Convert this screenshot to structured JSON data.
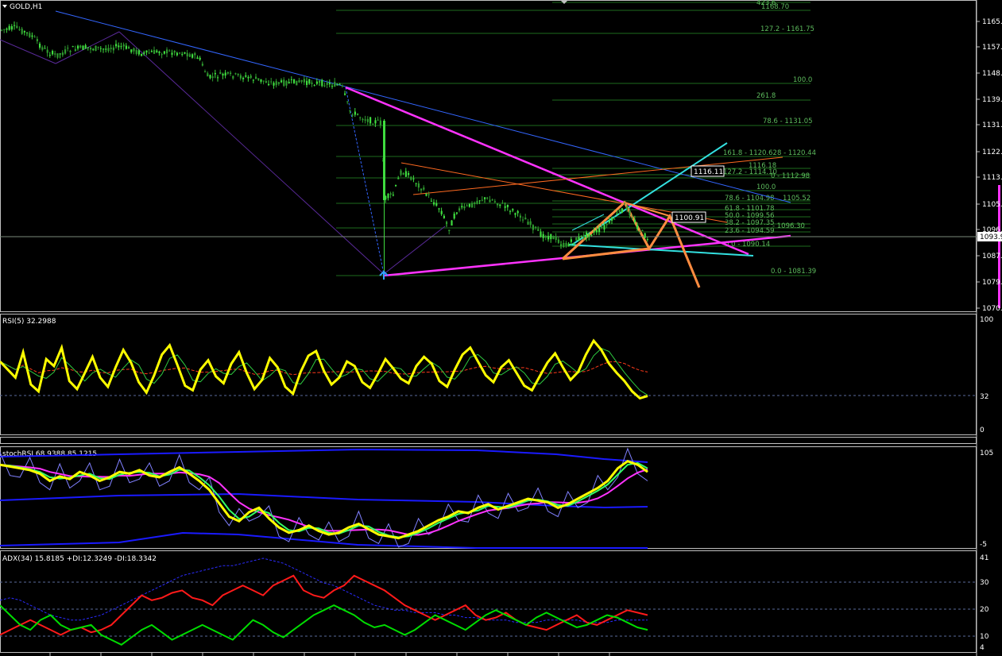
{
  "chart_title": "GOLD,H1",
  "colors": {
    "background": "#000000",
    "bull_candle": "#3fdc3f",
    "bear_candle": "#2f9a2f",
    "fib_line": "#1e6b1e",
    "fib_text": "#5dbb5d",
    "magenta": "#ff33ff",
    "blue_line": "#3366ff",
    "cyan": "#33e0e0",
    "orange": "#ff8040",
    "rsi": "#ffff00",
    "stoch_main": "#ffff00",
    "stoch_ma": "#ff33ff",
    "stoch_green": "#33ff66",
    "band": "#1a1aff",
    "adx_plus": "#00dd00",
    "adx_minus": "#ff1a1a",
    "adx_main": "#2b2bff"
  },
  "price_axis": {
    "ticks": [
      "1165.7",
      "1157.0",
      "1148.2",
      "1139.5",
      "1131.0",
      "1122.2",
      "1113.7",
      "1105.0",
      "1096.2",
      "1087.7",
      "1079.0",
      "1070.5"
    ],
    "current_price": "1093.9"
  },
  "fib_labels": {
    "f_423": "423.6",
    "f_top": "1168.70",
    "f_1272": "127.2 - 1161.75",
    "f_100a": "100.0",
    "f_2618": "261.8",
    "f_786a": "78.6 - 1131.05",
    "f_1618": "161.8 - 1120.628 - 1120.44",
    "f_1116": "1116.18",
    "f_1272b": "127.2 - 1114.10",
    "f_11298": "0 - 1112.98",
    "f_100b": "100.0",
    "f_786b": "78.6 - 1104.98",
    "f_10552": "1105.52",
    "f_618": "61.8 - 1101.78",
    "f_500": "50.0 - 1099.56",
    "f_382": "38.2 - 1097.35",
    "f_10963": "- 1096.30",
    "f_236": "23.6 - 1094.59",
    "f_0a": "0.0 - 1090.14",
    "f_0b": "0.0 - 1081.39"
  },
  "price_boxes": {
    "box1": "1116.11",
    "box2": "1100.91"
  },
  "rsi": {
    "label": "RSI(5) 32.2988",
    "axis": [
      "100",
      "32",
      "0"
    ],
    "series": [
      62,
      55,
      48,
      70,
      42,
      36,
      64,
      58,
      74,
      45,
      38,
      52,
      66,
      48,
      40,
      57,
      72,
      61,
      44,
      35,
      50,
      68,
      76,
      59,
      41,
      37,
      55,
      63,
      49,
      43,
      60,
      70,
      52,
      38,
      46,
      65,
      57,
      40,
      34,
      53,
      67,
      71,
      54,
      42,
      48,
      62,
      58,
      44,
      39,
      51,
      64,
      56,
      47,
      43,
      58,
      66,
      60,
      45,
      40,
      55,
      68,
      74,
      62,
      50,
      44,
      57,
      63,
      52,
      41,
      37,
      49,
      61,
      69,
      57,
      46,
      53,
      68,
      80,
      72,
      60,
      52,
      45,
      36,
      30,
      32
    ]
  },
  "stoch": {
    "label": "stochRSI 68.9388 85.1215",
    "axis": [
      "105",
      "-5"
    ],
    "main": [
      88,
      86,
      84,
      82,
      78,
      70,
      75,
      72,
      80,
      76,
      70,
      74,
      80,
      78,
      82,
      76,
      74,
      80,
      85,
      78,
      70,
      60,
      45,
      30,
      25,
      35,
      40,
      28,
      18,
      12,
      15,
      20,
      14,
      10,
      12,
      18,
      22,
      16,
      10,
      8,
      6,
      10,
      14,
      20,
      26,
      30,
      36,
      34,
      40,
      44,
      38,
      42,
      46,
      50,
      48,
      46,
      40,
      44,
      50,
      56,
      62,
      70,
      84,
      92,
      88,
      80
    ]
  },
  "adx": {
    "label": "ADX(34) 15.8185  +DI:12.3249  -DI:18.3342",
    "axis": [
      "41",
      "30",
      "20",
      "10",
      "4"
    ],
    "plus_di": [
      22,
      18,
      14,
      12,
      16,
      18,
      14,
      12,
      13,
      14,
      10,
      8,
      6,
      9,
      12,
      14,
      11,
      8,
      10,
      12,
      14,
      12,
      10,
      8,
      12,
      16,
      14,
      11,
      9,
      12,
      15,
      18,
      20,
      22,
      20,
      18,
      15,
      13,
      14,
      12,
      10,
      12,
      15,
      18,
      16,
      14,
      12,
      15,
      18,
      20,
      18,
      16,
      14,
      17,
      19,
      17,
      15,
      13,
      14,
      16,
      18,
      17,
      15,
      13,
      12
    ],
    "minus_di": [
      10,
      12,
      14,
      16,
      14,
      12,
      10,
      12,
      13,
      11,
      12,
      14,
      18,
      22,
      26,
      24,
      25,
      27,
      28,
      25,
      24,
      22,
      26,
      28,
      30,
      28,
      26,
      30,
      32,
      34,
      28,
      26,
      25,
      28,
      30,
      34,
      32,
      30,
      28,
      25,
      22,
      20,
      18,
      16,
      18,
      20,
      22,
      18,
      16,
      17,
      19,
      16,
      14,
      13,
      12,
      14,
      16,
      18,
      15,
      14,
      16,
      18,
      20,
      19,
      18
    ],
    "adx_line": [
      24,
      25,
      24,
      22,
      20,
      18,
      17,
      16,
      16,
      17,
      18,
      20,
      22,
      24,
      26,
      28,
      30,
      32,
      34,
      35,
      36,
      37,
      38,
      38,
      39,
      40,
      41,
      40,
      39,
      37,
      35,
      33,
      31,
      30,
      28,
      26,
      24,
      22,
      21,
      20,
      20,
      19,
      19,
      19,
      18,
      18,
      17,
      17,
      16,
      16,
      16,
      15,
      15,
      15,
      16,
      16,
      16,
      16,
      15,
      15,
      15,
      16,
      16,
      16,
      16
    ]
  }
}
